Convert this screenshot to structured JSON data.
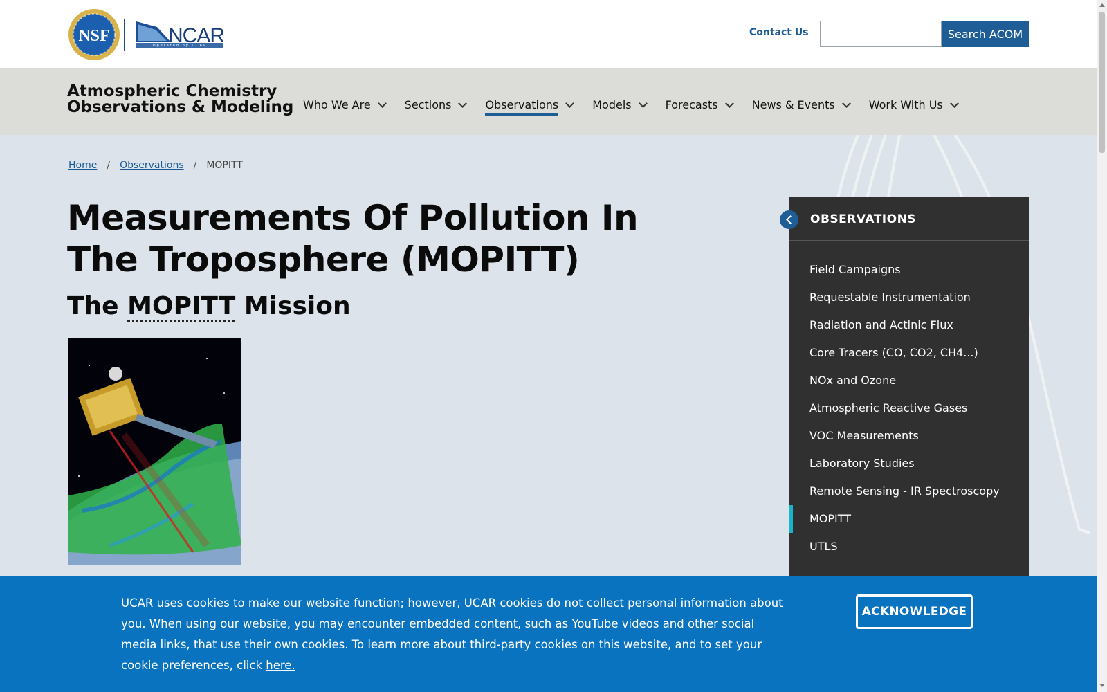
{
  "header": {
    "contact_label": "Contact Us",
    "search_button_label": "Search ACOM",
    "search_value": "",
    "ncar_logo_text": "NCAR",
    "ncar_logo_subtext": "Operated by UCAR",
    "nsf_logo_text": "NSF"
  },
  "site": {
    "title_line1": "Atmospheric Chemistry",
    "title_line2": "Observations & Modeling"
  },
  "nav": {
    "items": [
      {
        "label": "Who We Are"
      },
      {
        "label": "Sections"
      },
      {
        "label": "Observations",
        "active": true
      },
      {
        "label": "Models"
      },
      {
        "label": "Forecasts"
      },
      {
        "label": "News & Events"
      },
      {
        "label": "Work With Us"
      }
    ]
  },
  "breadcrumb": {
    "home": "Home",
    "observations": "Observations",
    "current": "MOPITT",
    "separator": "/"
  },
  "main": {
    "title": "Measurements Of Pollution In The Troposphere (MOPITT)",
    "subheading_prefix": "The",
    "subheading_abbr": "MOPITT",
    "subheading_suffix": "Mission"
  },
  "sidebar": {
    "title": "OBSERVATIONS",
    "items": [
      {
        "label": "Field Campaigns"
      },
      {
        "label": "Requestable Instrumentation"
      },
      {
        "label": "Radiation and Actinic Flux"
      },
      {
        "label": "Core Tracers (CO, CO2, CH4...)"
      },
      {
        "label": "NOx and Ozone"
      },
      {
        "label": "Atmospheric Reactive Gases"
      },
      {
        "label": "VOC Measurements"
      },
      {
        "label": "Laboratory Studies"
      },
      {
        "label": "Remote Sensing - IR Spectroscopy"
      },
      {
        "label": "MOPITT",
        "current": true
      },
      {
        "label": "UTLS"
      }
    ]
  },
  "cookie": {
    "text": "UCAR uses cookies to make our website function; however, UCAR cookies do not collect personal information about you. When using our website, you may encounter embedded content, such as YouTube videos and other social media links, that use their own cookies. To learn more about third-party cookies on this website, and to set your cookie preferences, click",
    "link_label": "here.",
    "button_label": "ACKNOWLEDGE"
  },
  "colors": {
    "accent_blue": "#1f5d96",
    "cookie_banner": "#0a73c0",
    "sidebar_bg": "#303030",
    "current_marker": "#1ab4c8"
  }
}
